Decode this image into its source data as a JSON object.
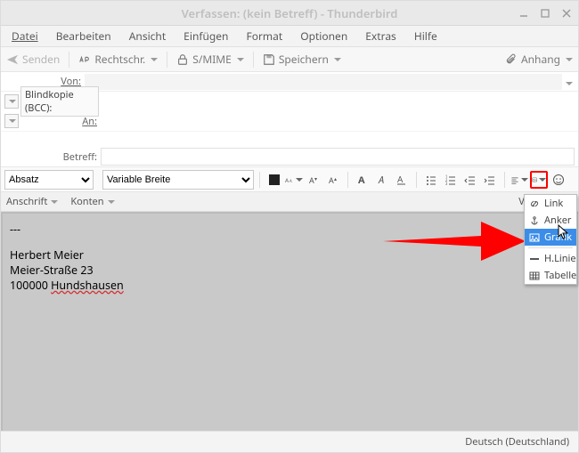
{
  "window": {
    "title": "Verfassen: (kein Betreff) - Thunderbird"
  },
  "menubar": [
    "Datei",
    "Bearbeiten",
    "Ansicht",
    "Einfügen",
    "Format",
    "Optionen",
    "Extras",
    "Hilfe"
  ],
  "toolbar": {
    "send": "Senden",
    "spell": "Rechtschr.",
    "smime": "S/MIME",
    "save": "Speichern",
    "attach": "Anhang"
  },
  "headers": {
    "from_label": "Von:",
    "bcc_label": "Blindkopie (BCC):",
    "to_label": "An:",
    "subject_label": "Betreff:"
  },
  "formatbar": {
    "paragraph": "Absatz",
    "font": "Variable Breite"
  },
  "subbar": {
    "anschrift": "Anschrift",
    "konten": "Konten",
    "variablen": "Variablen"
  },
  "body": {
    "dash": "---",
    "name": "Herbert Meier",
    "street": "Meier-Straße 23",
    "zip": "100000 ",
    "city": "Hundshausen"
  },
  "statusbar": {
    "lang": "Deutsch (Deutschland)"
  },
  "insert_menu": {
    "link": "Link",
    "anker": "Anker",
    "grafik": "Grafik",
    "hlinie": "H.Linie",
    "tabelle": "Tabelle"
  }
}
